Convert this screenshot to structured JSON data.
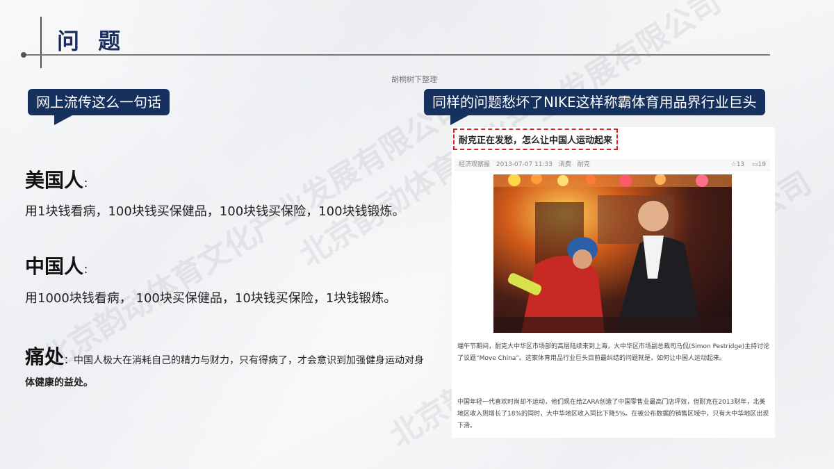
{
  "header": {
    "title": "问 题",
    "source_note": "胡桐树下整理"
  },
  "watermark": {
    "text": "北京韵动体育文化产业发展有限公司"
  },
  "banners": {
    "left": "网上流传这么一句话",
    "right": "同样的问题愁坏了NIKE这样称霸体育用品界行业巨头"
  },
  "sections": {
    "american": {
      "heading": "美国人",
      "colon": "：",
      "text": "用1块钱看病，100块钱买保健品，100块钱买保险，100块钱锻炼。"
    },
    "chinese": {
      "heading": "中国人",
      "colon": "：",
      "text": "用1000块钱看病， 100块买保健品，10块钱买保险，1块钱锻炼。"
    },
    "pain": {
      "heading": "痛处",
      "inline_text": "：中国人极大在消耗自己的精力与财力，只有得病了，才会意识到加强健身运动对身",
      "text_line2": "体健康的益处。"
    }
  },
  "article": {
    "title": "耐克正在发愁，怎么让中国人运动起来",
    "meta": {
      "source": "经济观察报",
      "date": "2013-07-07 11:33",
      "tag1": "消费",
      "tag2": "耐克",
      "likes": "☆13",
      "comments": "▭19"
    },
    "paragraph1": "端午节期间，耐克大中华区市场部的高层陆续来到上海，大中华区市场副总裁司马侃(Simon Pestridge)主持讨论了议题“Move China”。这家体育用品行业巨头目前最纠结的问题就是，如何让中国人运动起来。",
    "paragraph2": "中国年轻一代喜欢时尚却不运动，他们现在给ZARA创造了中国零售业最高门店坪效，但耐克在2013财年，北美地区收入则增长了18%的同时，大中华地区收入同比下降5%。在被公布数据的销售区域中，只有大中华地区出现下滑。"
  }
}
